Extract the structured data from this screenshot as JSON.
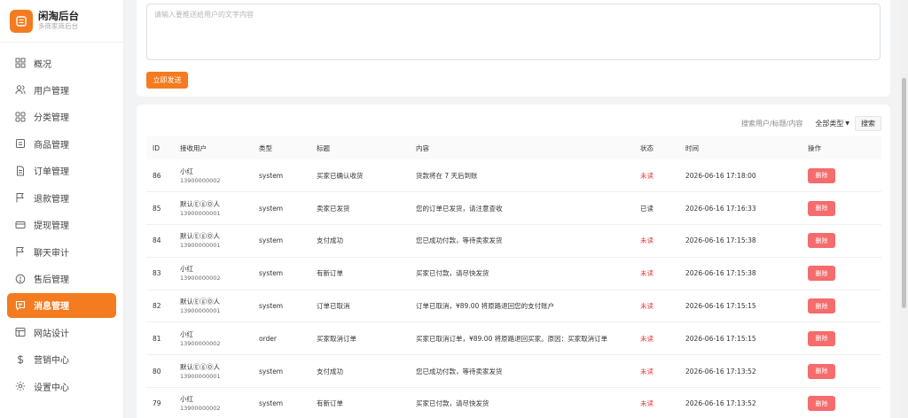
{
  "brand": {
    "title": "闲淘后台",
    "subtitle": "多商家商后台"
  },
  "nav": [
    {
      "label": "概况",
      "icon": "grid-icon"
    },
    {
      "label": "用户管理",
      "icon": "users-icon"
    },
    {
      "label": "分类管理",
      "icon": "apps-icon"
    },
    {
      "label": "商品管理",
      "icon": "box-icon"
    },
    {
      "label": "订单管理",
      "icon": "document-icon"
    },
    {
      "label": "退款管理",
      "icon": "flag-icon"
    },
    {
      "label": "提现管理",
      "icon": "card-icon"
    },
    {
      "label": "聊天审计",
      "icon": "flag-icon"
    },
    {
      "label": "售后管理",
      "icon": "info-icon"
    },
    {
      "label": "消息管理",
      "icon": "message-icon",
      "active": true
    },
    {
      "label": "网站设计",
      "icon": "layout-icon"
    },
    {
      "label": "营销中心",
      "icon": "dollar-icon"
    },
    {
      "label": "设置中心",
      "icon": "gear-icon"
    }
  ],
  "compose": {
    "placeholder": "请输入要推送给用户的文字内容",
    "send_label": "立即发送"
  },
  "filter": {
    "search_placeholder": "搜索用户/标题/内容",
    "type_label": "全部类型",
    "search_label": "搜索"
  },
  "table": {
    "headers": [
      "ID",
      "接收用户",
      "类型",
      "标题",
      "内容",
      "状态",
      "时间",
      "操作"
    ],
    "delete_label": "删除",
    "rows": [
      {
        "id": "86",
        "name": "小红",
        "phone": "13900000002",
        "type": "system",
        "title": "买家已确认收货",
        "content": "货款将在 7 天后到账",
        "status": "未读",
        "time": "2026-06-16 17:18:00"
      },
      {
        "id": "85",
        "name": "默认ⒺⓖⓄ人",
        "phone": "13900000001",
        "type": "system",
        "title": "卖家已发货",
        "content": "您的订单已发货，请注意查收",
        "status": "已读",
        "time": "2026-06-16 17:16:33"
      },
      {
        "id": "84",
        "name": "默认ⒺⓖⓄ人",
        "phone": "13900000001",
        "type": "system",
        "title": "支付成功",
        "content": "您已成功付款，等待卖家发货",
        "status": "未读",
        "time": "2026-06-16 17:15:38"
      },
      {
        "id": "83",
        "name": "小红",
        "phone": "13900000002",
        "type": "system",
        "title": "有新订单",
        "content": "买家已付款，请尽快发货",
        "status": "未读",
        "time": "2026-06-16 17:15:38"
      },
      {
        "id": "82",
        "name": "默认ⒺⓖⓄ人",
        "phone": "13900000001",
        "type": "system",
        "title": "订单已取消",
        "content": "订单已取消，¥89.00 将原路退回您的支付账户",
        "status": "未读",
        "time": "2026-06-16 17:15:15"
      },
      {
        "id": "81",
        "name": "小红",
        "phone": "13900000002",
        "type": "order",
        "title": "买家取消订单",
        "content": "买家已取消订单，¥89.00 将原路退回买家。原因：买家取消订单",
        "status": "未读",
        "time": "2026-06-16 17:15:15"
      },
      {
        "id": "80",
        "name": "默认ⒺⓖⓄ人",
        "phone": "13900000001",
        "type": "system",
        "title": "支付成功",
        "content": "您已成功付款，等待卖家发货",
        "status": "未读",
        "time": "2026-06-16 17:13:52"
      },
      {
        "id": "79",
        "name": "小红",
        "phone": "13900000002",
        "type": "system",
        "title": "有新订单",
        "content": "买家已付款，请尽快发货",
        "status": "未读",
        "time": "2026-06-16 17:13:52"
      }
    ]
  },
  "colors": {
    "accent": "#f47b20",
    "danger": "#f56c6c",
    "unread": "#e4393c"
  }
}
